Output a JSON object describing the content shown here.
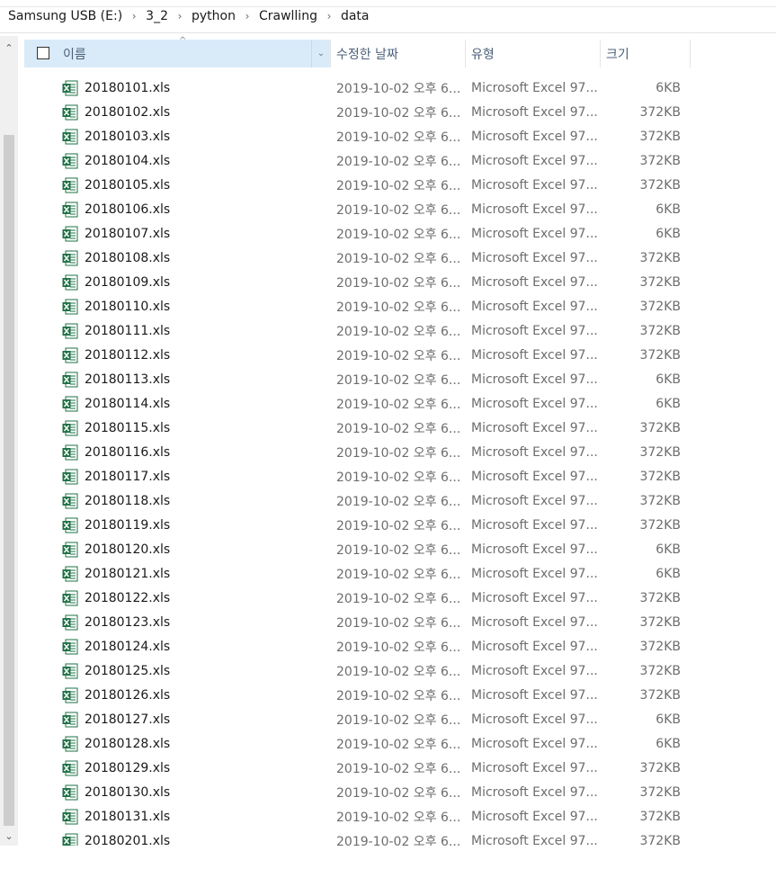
{
  "breadcrumb": [
    "Samsung USB (E:)",
    "3_2",
    "python",
    "Crawlling",
    "data"
  ],
  "columns": {
    "name": "이름",
    "date": "수정한 날짜",
    "type": "유형",
    "size": "크기"
  },
  "icons": {
    "file": "excel-file-icon",
    "sep": "chevron-right-icon",
    "sort": "sort-ascending-icon",
    "dropdown": "chevron-down-icon",
    "scroll_up": "scroll-up-icon",
    "scroll_down": "scroll-down-icon"
  },
  "glyphs": {
    "sep": "›",
    "sort": "^",
    "dropdown": "⌄",
    "scroll_up": "⌃",
    "scroll_down": "⌄"
  },
  "colors": {
    "header_selected": "#d9ebf9",
    "excel_green": "#1e7145"
  },
  "files": [
    {
      "name": "20180101.xls",
      "date": "2019-10-02 오후 6...",
      "type": "Microsoft Excel 97...",
      "size": "6KB"
    },
    {
      "name": "20180102.xls",
      "date": "2019-10-02 오후 6...",
      "type": "Microsoft Excel 97...",
      "size": "372KB"
    },
    {
      "name": "20180103.xls",
      "date": "2019-10-02 오후 6...",
      "type": "Microsoft Excel 97...",
      "size": "372KB"
    },
    {
      "name": "20180104.xls",
      "date": "2019-10-02 오후 6...",
      "type": "Microsoft Excel 97...",
      "size": "372KB"
    },
    {
      "name": "20180105.xls",
      "date": "2019-10-02 오후 6...",
      "type": "Microsoft Excel 97...",
      "size": "372KB"
    },
    {
      "name": "20180106.xls",
      "date": "2019-10-02 오후 6...",
      "type": "Microsoft Excel 97...",
      "size": "6KB"
    },
    {
      "name": "20180107.xls",
      "date": "2019-10-02 오후 6...",
      "type": "Microsoft Excel 97...",
      "size": "6KB"
    },
    {
      "name": "20180108.xls",
      "date": "2019-10-02 오후 6...",
      "type": "Microsoft Excel 97...",
      "size": "372KB"
    },
    {
      "name": "20180109.xls",
      "date": "2019-10-02 오후 6...",
      "type": "Microsoft Excel 97...",
      "size": "372KB"
    },
    {
      "name": "20180110.xls",
      "date": "2019-10-02 오후 6...",
      "type": "Microsoft Excel 97...",
      "size": "372KB"
    },
    {
      "name": "20180111.xls",
      "date": "2019-10-02 오후 6...",
      "type": "Microsoft Excel 97...",
      "size": "372KB"
    },
    {
      "name": "20180112.xls",
      "date": "2019-10-02 오후 6...",
      "type": "Microsoft Excel 97...",
      "size": "372KB"
    },
    {
      "name": "20180113.xls",
      "date": "2019-10-02 오후 6...",
      "type": "Microsoft Excel 97...",
      "size": "6KB"
    },
    {
      "name": "20180114.xls",
      "date": "2019-10-02 오후 6...",
      "type": "Microsoft Excel 97...",
      "size": "6KB"
    },
    {
      "name": "20180115.xls",
      "date": "2019-10-02 오후 6...",
      "type": "Microsoft Excel 97...",
      "size": "372KB"
    },
    {
      "name": "20180116.xls",
      "date": "2019-10-02 오후 6...",
      "type": "Microsoft Excel 97...",
      "size": "372KB"
    },
    {
      "name": "20180117.xls",
      "date": "2019-10-02 오후 6...",
      "type": "Microsoft Excel 97...",
      "size": "372KB"
    },
    {
      "name": "20180118.xls",
      "date": "2019-10-02 오후 6...",
      "type": "Microsoft Excel 97...",
      "size": "372KB"
    },
    {
      "name": "20180119.xls",
      "date": "2019-10-02 오후 6...",
      "type": "Microsoft Excel 97...",
      "size": "372KB"
    },
    {
      "name": "20180120.xls",
      "date": "2019-10-02 오후 6...",
      "type": "Microsoft Excel 97...",
      "size": "6KB"
    },
    {
      "name": "20180121.xls",
      "date": "2019-10-02 오후 6...",
      "type": "Microsoft Excel 97...",
      "size": "6KB"
    },
    {
      "name": "20180122.xls",
      "date": "2019-10-02 오후 6...",
      "type": "Microsoft Excel 97...",
      "size": "372KB"
    },
    {
      "name": "20180123.xls",
      "date": "2019-10-02 오후 6...",
      "type": "Microsoft Excel 97...",
      "size": "372KB"
    },
    {
      "name": "20180124.xls",
      "date": "2019-10-02 오후 6...",
      "type": "Microsoft Excel 97...",
      "size": "372KB"
    },
    {
      "name": "20180125.xls",
      "date": "2019-10-02 오후 6...",
      "type": "Microsoft Excel 97...",
      "size": "372KB"
    },
    {
      "name": "20180126.xls",
      "date": "2019-10-02 오후 6...",
      "type": "Microsoft Excel 97...",
      "size": "372KB"
    },
    {
      "name": "20180127.xls",
      "date": "2019-10-02 오후 6...",
      "type": "Microsoft Excel 97...",
      "size": "6KB"
    },
    {
      "name": "20180128.xls",
      "date": "2019-10-02 오후 6...",
      "type": "Microsoft Excel 97...",
      "size": "6KB"
    },
    {
      "name": "20180129.xls",
      "date": "2019-10-02 오후 6...",
      "type": "Microsoft Excel 97...",
      "size": "372KB"
    },
    {
      "name": "20180130.xls",
      "date": "2019-10-02 오후 6...",
      "type": "Microsoft Excel 97...",
      "size": "372KB"
    },
    {
      "name": "20180131.xls",
      "date": "2019-10-02 오후 6...",
      "type": "Microsoft Excel 97...",
      "size": "372KB"
    },
    {
      "name": "20180201.xls",
      "date": "2019-10-02 오후 6...",
      "type": "Microsoft Excel 97...",
      "size": "372KB"
    }
  ]
}
